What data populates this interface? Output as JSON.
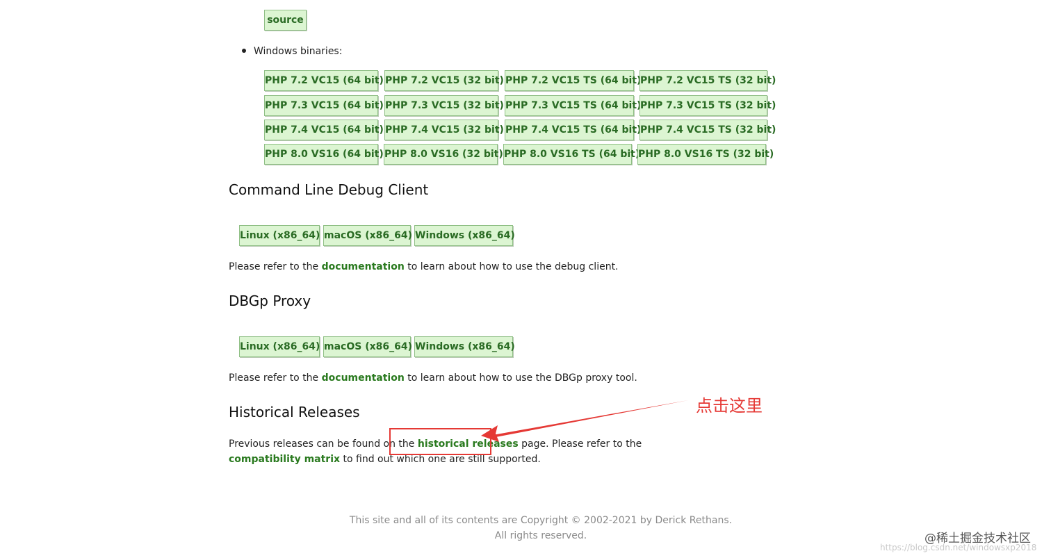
{
  "source_button": "source",
  "windows_binaries_label": "Windows binaries:",
  "windows_buttons": [
    [
      "PHP 7.2 VC15 (64 bit)",
      "PHP 7.2 VC15 (32 bit)",
      "PHP 7.2 VC15 TS (64 bit)",
      "PHP 7.2 VC15 TS (32 bit)"
    ],
    [
      "PHP 7.3 VC15 (64 bit)",
      "PHP 7.3 VC15 (32 bit)",
      "PHP 7.3 VC15 TS (64 bit)",
      "PHP 7.3 VC15 TS (32 bit)"
    ],
    [
      "PHP 7.4 VC15 (64 bit)",
      "PHP 7.4 VC15 (32 bit)",
      "PHP 7.4 VC15 TS (64 bit)",
      "PHP 7.4 VC15 TS (32 bit)"
    ],
    [
      "PHP 8.0 VS16 (64 bit)",
      "PHP 8.0 VS16 (32 bit)",
      "PHP 8.0 VS16 TS (64 bit)",
      "PHP 8.0 VS16 TS (32 bit)"
    ]
  ],
  "cli": {
    "heading": "Command Line Debug Client",
    "buttons": [
      "Linux (x86_64)",
      "macOS (x86_64)",
      "Windows (x86_64)"
    ],
    "text_before": "Please refer to the ",
    "link": "documentation",
    "text_after": " to learn about how to use the debug client."
  },
  "proxy": {
    "heading": "DBGp Proxy",
    "buttons": [
      "Linux (x86_64)",
      "macOS (x86_64)",
      "Windows (x86_64)"
    ],
    "text_before": "Please refer to the ",
    "link": "documentation",
    "text_after": " to learn about how to use the DBGp proxy tool."
  },
  "historical": {
    "heading": "Historical Releases",
    "text_before": "Previous releases can be found on the ",
    "link": "historical releases",
    "text_mid": " page. Please refer to the",
    "link2": "compatibility matrix",
    "text_after": " to find out which one are still supported."
  },
  "footer": {
    "line1": "This site and all of its contents are Copyright © 2002-2021 by Derick Rethans.",
    "line2": "All rights reserved."
  },
  "annotation": {
    "text": "点击这里",
    "color": "#e53935"
  },
  "watermark": {
    "main": "@稀土掘金技术社区",
    "sub": "https://blog.csdn.net/windowsxp2018"
  },
  "colors": {
    "button_bg": "#dcf5d2",
    "button_text": "#2a6b24",
    "link": "#2a7a1f"
  }
}
